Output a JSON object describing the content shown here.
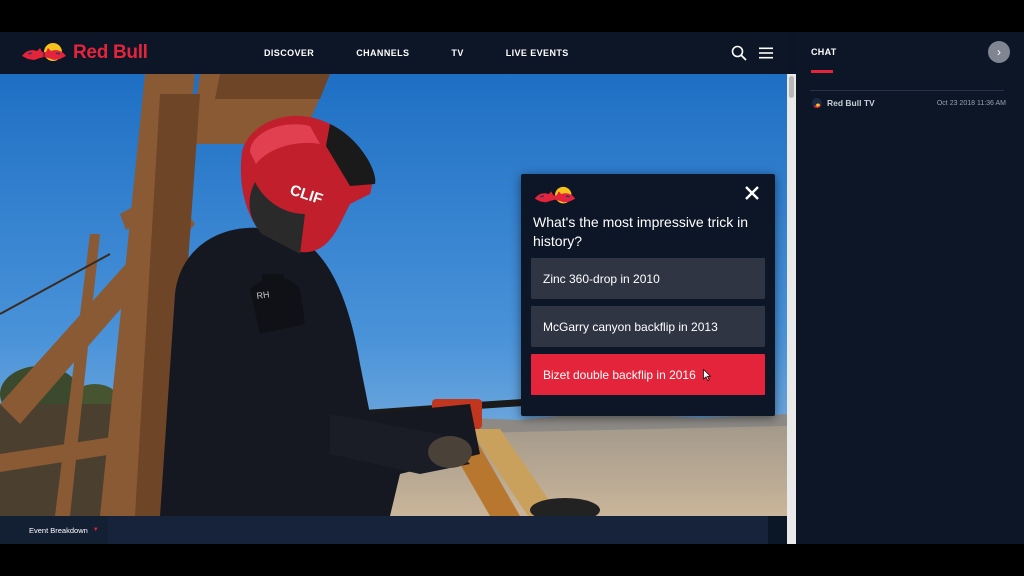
{
  "brand": {
    "name": "Red Bull",
    "accent": "#e4243a"
  },
  "nav": [
    {
      "label": "DISCOVER"
    },
    {
      "label": "CHANNELS"
    },
    {
      "label": "TV"
    },
    {
      "label": "LIVE EVENTS"
    }
  ],
  "header_icons": {
    "search": "search-icon",
    "menu": "hamburger-menu-icon"
  },
  "chat": {
    "tab_label": "CHAT",
    "collapse_icon": "chevron-right-icon",
    "messages": [
      {
        "user": "Red Bull TV",
        "time": "Oct 23 2018 11:36 AM"
      }
    ]
  },
  "poll": {
    "question": "What's the most impressive trick in history?",
    "close_icon": "close-icon",
    "options": [
      {
        "label": "Zinc 360-drop in 2010"
      },
      {
        "label": "McGarry canyon backflip in 2013"
      },
      {
        "label": "Bizet double backflip in 2016"
      }
    ]
  },
  "event_bar": {
    "label": "Event Breakdown"
  }
}
